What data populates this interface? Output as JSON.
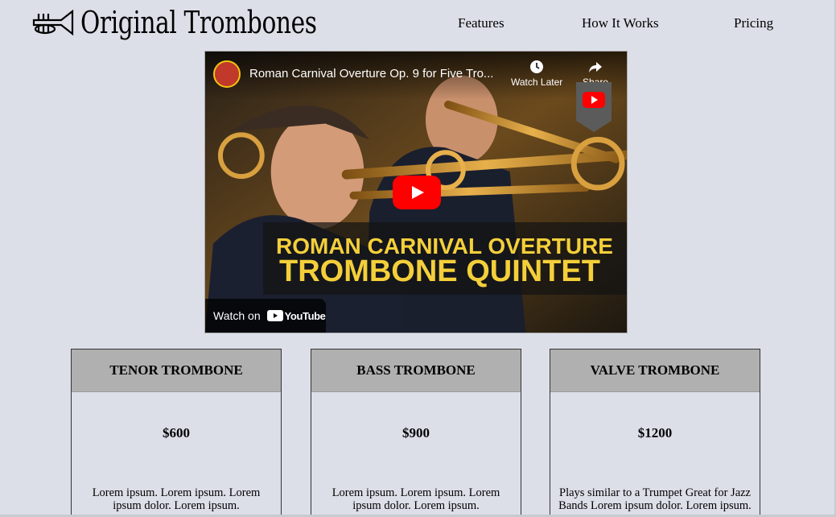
{
  "header": {
    "logo_icon": "trumpet-icon",
    "logo_text": "Original Trombones",
    "nav": [
      {
        "label": "Features"
      },
      {
        "label": "How It Works"
      },
      {
        "label": "Pricing"
      }
    ]
  },
  "video": {
    "title": "Roman Carnival Overture Op. 9 for Five Tro...",
    "watch_later_label": "Watch Later",
    "share_label": "Share",
    "overlay_line1": "ROMAN CARNIVAL OVERTURE",
    "overlay_line2": "TROMBONE QUINTET",
    "watch_on_label": "Watch on",
    "youtube_word": "YouTube",
    "icons": [
      "clock-icon",
      "share-arrow-icon",
      "play-icon",
      "youtube-logo-icon"
    ]
  },
  "cards": [
    {
      "title": "TENOR TROMBONE",
      "price": "$600",
      "description": "Lorem ipsum. Lorem ipsum. Lorem ipsum dolor. Lorem ipsum."
    },
    {
      "title": "BASS TROMBONE",
      "price": "$900",
      "description": "Lorem ipsum. Lorem ipsum. Lorem ipsum dolor. Lorem ipsum."
    },
    {
      "title": "VALVE TROMBONE",
      "price": "$1200",
      "description": "Plays similar to a Trumpet Great for Jazz Bands Lorem ipsum dolor. Lorem ipsum."
    }
  ],
  "colors": {
    "page_background": "#dcdfe8",
    "card_header": "#b0b0b0",
    "youtube_red": "#ff0000",
    "overlay_text": "#f4cf3a"
  }
}
